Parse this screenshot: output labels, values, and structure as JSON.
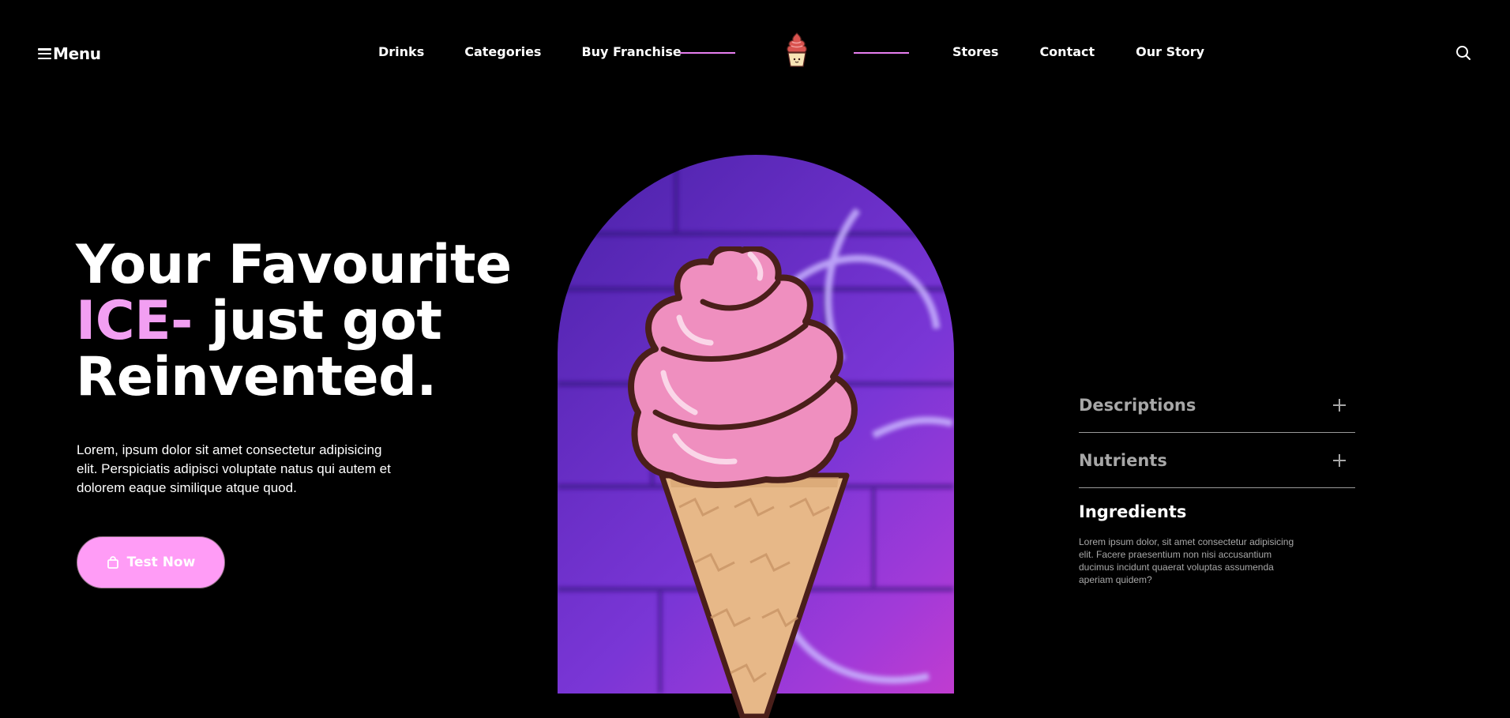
{
  "header": {
    "menu_label": "Menu",
    "nav_left": [
      {
        "label": "Drinks"
      },
      {
        "label": "Categories"
      },
      {
        "label": "Buy Franchise"
      }
    ],
    "nav_right": [
      {
        "label": "Stores"
      },
      {
        "label": "Contact"
      },
      {
        "label": "Our Story"
      }
    ],
    "logo_icon": "ice-cream-cupcake-logo",
    "search_icon": "search-icon",
    "accent_color": "#e77ef0"
  },
  "hero": {
    "title_line1": "Your Favourite",
    "title_pink": "ICE-",
    "title_line2_rest": " just got",
    "title_line3": "Reinvented.",
    "description": "Lorem, ipsum dolor sit amet consectetur adipisicing elit. Perspiciatis adipisci voluptate natus qui autem et dolorem eaque similique atque quod.",
    "cta_label": "Test Now",
    "cta_icon": "shopping-bag-icon",
    "cta_color": "#ff9cf6",
    "pink_color": "#f29ff2"
  },
  "details": {
    "items": [
      {
        "label": "Descriptions",
        "icon": "plus-icon"
      },
      {
        "label": "Nutrients",
        "icon": "plus-icon"
      }
    ],
    "open_item": {
      "label": "Ingredients",
      "body": "Lorem ipsum dolor, sit amet consectetur adipisicing elit. Facere praesentium non nisi accusantium ducimus incidunt quaerat voluptas assumenda aperiam quidem?"
    }
  }
}
